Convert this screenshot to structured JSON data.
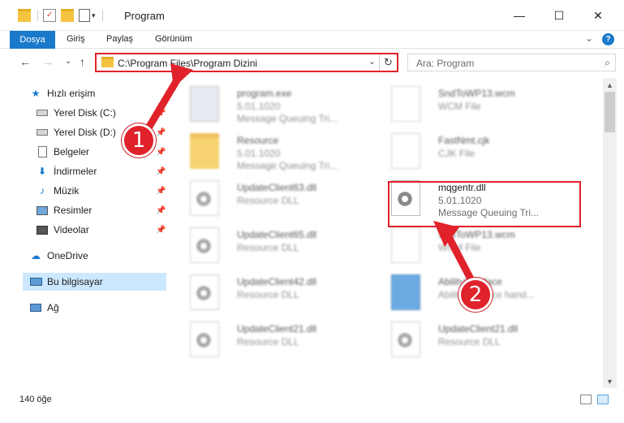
{
  "window": {
    "title": "Program",
    "minimize": "—",
    "maximize": "☐",
    "close": "✕"
  },
  "ribbon": {
    "file_tab": "Dosya",
    "tabs": [
      "Giriş",
      "Paylaş",
      "Görünüm"
    ],
    "collapse": "⌄",
    "help": "?"
  },
  "nav": {
    "back": "←",
    "forward": "→",
    "recent": "⌄",
    "up": "↑",
    "address": "C:\\Program Files\\Program Dizini",
    "address_dropdown": "⌄",
    "refresh": "↻",
    "search_placeholder": "Ara: Program",
    "search_icon": "⌕"
  },
  "sidebar": {
    "quick_access": "Hızlı erişim",
    "items": [
      {
        "label": "Yerel Disk (C:)",
        "icon": "drive-icon"
      },
      {
        "label": "Yerel Disk (D:)",
        "icon": "drive-icon"
      },
      {
        "label": "Belgeler",
        "icon": "documents-icon"
      },
      {
        "label": "İndirmeler",
        "icon": "download-icon"
      },
      {
        "label": "Müzik",
        "icon": "music-icon"
      },
      {
        "label": "Resimler",
        "icon": "pictures-icon"
      },
      {
        "label": "Videolar",
        "icon": "videos-icon"
      }
    ],
    "onedrive": "OneDrive",
    "this_pc": "Bu bilgisayar",
    "network": "Ağ"
  },
  "files": [
    {
      "name": "program.exe",
      "l1": "5.01.1020",
      "l2": "Message Queuing Tri...",
      "kind": "exe",
      "blur": true
    },
    {
      "name": "Resource",
      "l1": "5.01.1020",
      "l2": "Message Queuing Tri...",
      "kind": "folder",
      "blur": true
    },
    {
      "name": "UpdateClient63.dll",
      "l1": "Resource DLL",
      "l2": "",
      "kind": "dll",
      "blur": true
    },
    {
      "name": "UpdateClient65.dll",
      "l1": "Resource DLL",
      "l2": "",
      "kind": "dll",
      "blur": true
    },
    {
      "name": "UpdateClient42.dll",
      "l1": "Resource DLL",
      "l2": "",
      "kind": "dll",
      "blur": true
    },
    {
      "name": "UpdateClient21.dll",
      "l1": "Resource DLL",
      "l2": "",
      "kind": "dll",
      "blur": true
    },
    {
      "name": "SndToWP13.wcm",
      "l1": "WCM File",
      "l2": "",
      "kind": "doc",
      "blur": true
    },
    {
      "name": "FastNmt.cjk",
      "l1": "CJK File",
      "l2": "",
      "kind": "doc",
      "blur": true
    },
    {
      "name": "mqgentr.dll",
      "l1": "5.01.1020",
      "l2": "Message Queuing Tri...",
      "kind": "dll",
      "blur": false
    },
    {
      "name": "SndToWP13.wcm",
      "l1": "WCM File",
      "l2": "",
      "kind": "doc",
      "blur": true
    },
    {
      "name": "AbilityInterface",
      "l1": "AbilityInterface hand...",
      "l2": "",
      "kind": "app",
      "blur": true
    },
    {
      "name": "UpdateClient21.dll",
      "l1": "Resource DLL",
      "l2": "",
      "kind": "dll",
      "blur": true
    }
  ],
  "status": {
    "count": "140 öğe"
  },
  "annotations": {
    "step1": "1",
    "step2": "2"
  },
  "colors": {
    "accent": "#1979ca",
    "highlight": "#e0222b"
  }
}
